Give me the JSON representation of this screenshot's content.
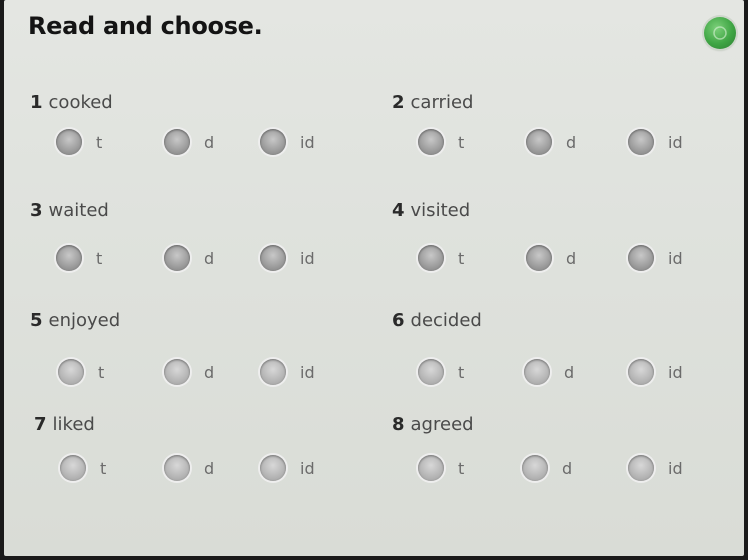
{
  "header": {
    "title": "Read and choose."
  },
  "questions": [
    {
      "number": "1",
      "word": "cooked",
      "options": [
        "t",
        "d",
        "id"
      ]
    },
    {
      "number": "2",
      "word": "carried",
      "options": [
        "t",
        "d",
        "id"
      ]
    },
    {
      "number": "3",
      "word": "waited",
      "options": [
        "t",
        "d",
        "id"
      ]
    },
    {
      "number": "4",
      "word": "visited",
      "options": [
        "t",
        "d",
        "id"
      ]
    },
    {
      "number": "5",
      "word": "enjoyed",
      "options": [
        "t",
        "d",
        "id"
      ]
    },
    {
      "number": "6",
      "word": "decided",
      "options": [
        "t",
        "d",
        "id"
      ]
    },
    {
      "number": "7",
      "word": "liked",
      "options": [
        "t",
        "d",
        "id"
      ]
    },
    {
      "number": "8",
      "word": "agreed",
      "options": [
        "t",
        "d",
        "id"
      ]
    }
  ],
  "colors": {
    "go_button": "#3fa544",
    "radio": "#9a9a9a",
    "background": "#e1e3df"
  }
}
